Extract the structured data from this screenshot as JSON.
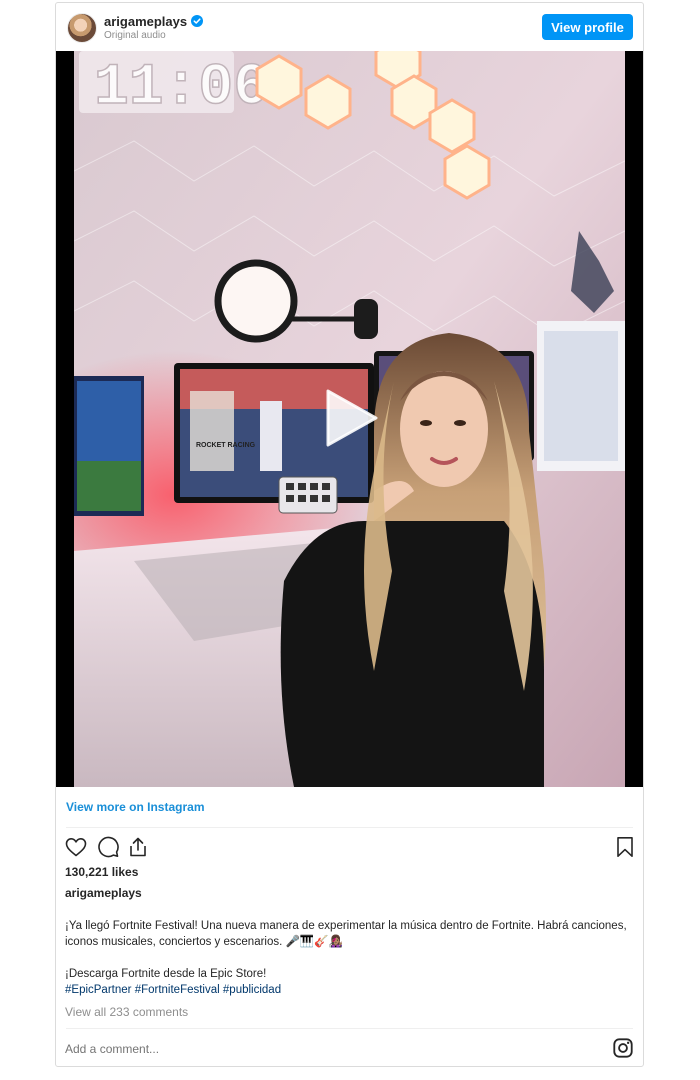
{
  "header": {
    "username": "arigameplays",
    "subtitle": "Original audio",
    "view_profile_label": "View profile"
  },
  "media": {
    "clock_text": "11:06",
    "monitor_text": "ROCKET RACING"
  },
  "links": {
    "view_more": "View more on Instagram"
  },
  "post": {
    "likes": "130,221 likes",
    "username": "arigameplays",
    "caption_line1": "¡Ya llegó Fortnite Festival! Una nueva manera de experimentar la música dentro de Fortnite. Habrá canciones, iconos musicales, conciertos y escenarios. 🎤🎹🎸👩🏽‍🎤",
    "caption_line2": "¡Descarga Fortnite desde la Epic Store!",
    "hashtags": [
      "#EpicPartner",
      "#FortniteFestival",
      "#publicidad"
    ],
    "view_comments": "View all 233 comments"
  },
  "comment": {
    "placeholder": "Add a comment..."
  },
  "colors": {
    "accent": "#0095f6",
    "link": "#1a8fd8",
    "hashtag": "#00376b",
    "muted": "#8e8e8e"
  },
  "icons": [
    "verified-badge-icon",
    "play-icon",
    "heart-icon",
    "comment-icon",
    "share-icon",
    "bookmark-icon",
    "instagram-icon"
  ]
}
